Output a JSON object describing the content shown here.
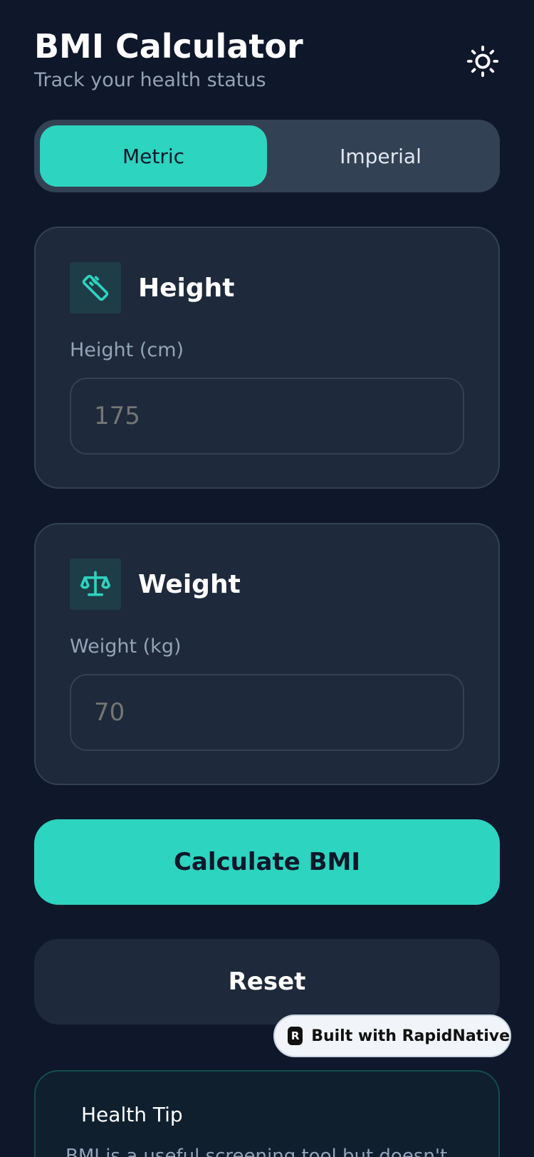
{
  "header": {
    "title": "BMI Calculator",
    "subtitle": "Track your health status",
    "theme_icon": "sun-icon"
  },
  "unit_toggle": {
    "options": [
      "Metric",
      "Imperial"
    ],
    "selected": "Metric"
  },
  "height_card": {
    "icon": "ruler-icon",
    "title": "Height",
    "label": "Height (cm)",
    "placeholder": "175"
  },
  "weight_card": {
    "icon": "scale-icon",
    "title": "Weight",
    "label": "Weight (kg)",
    "placeholder": "70"
  },
  "actions": {
    "calculate": "Calculate BMI",
    "reset": "Reset"
  },
  "badge": {
    "logo_letter": "R",
    "text": "Built with RapidNative"
  },
  "tip": {
    "title": "Health Tip",
    "text": "BMI is a useful screening tool but doesn't"
  },
  "colors": {
    "background": "#0f172a",
    "card": "#1e293b",
    "accent": "#2dd4bf",
    "muted_text": "#94a3b8"
  }
}
